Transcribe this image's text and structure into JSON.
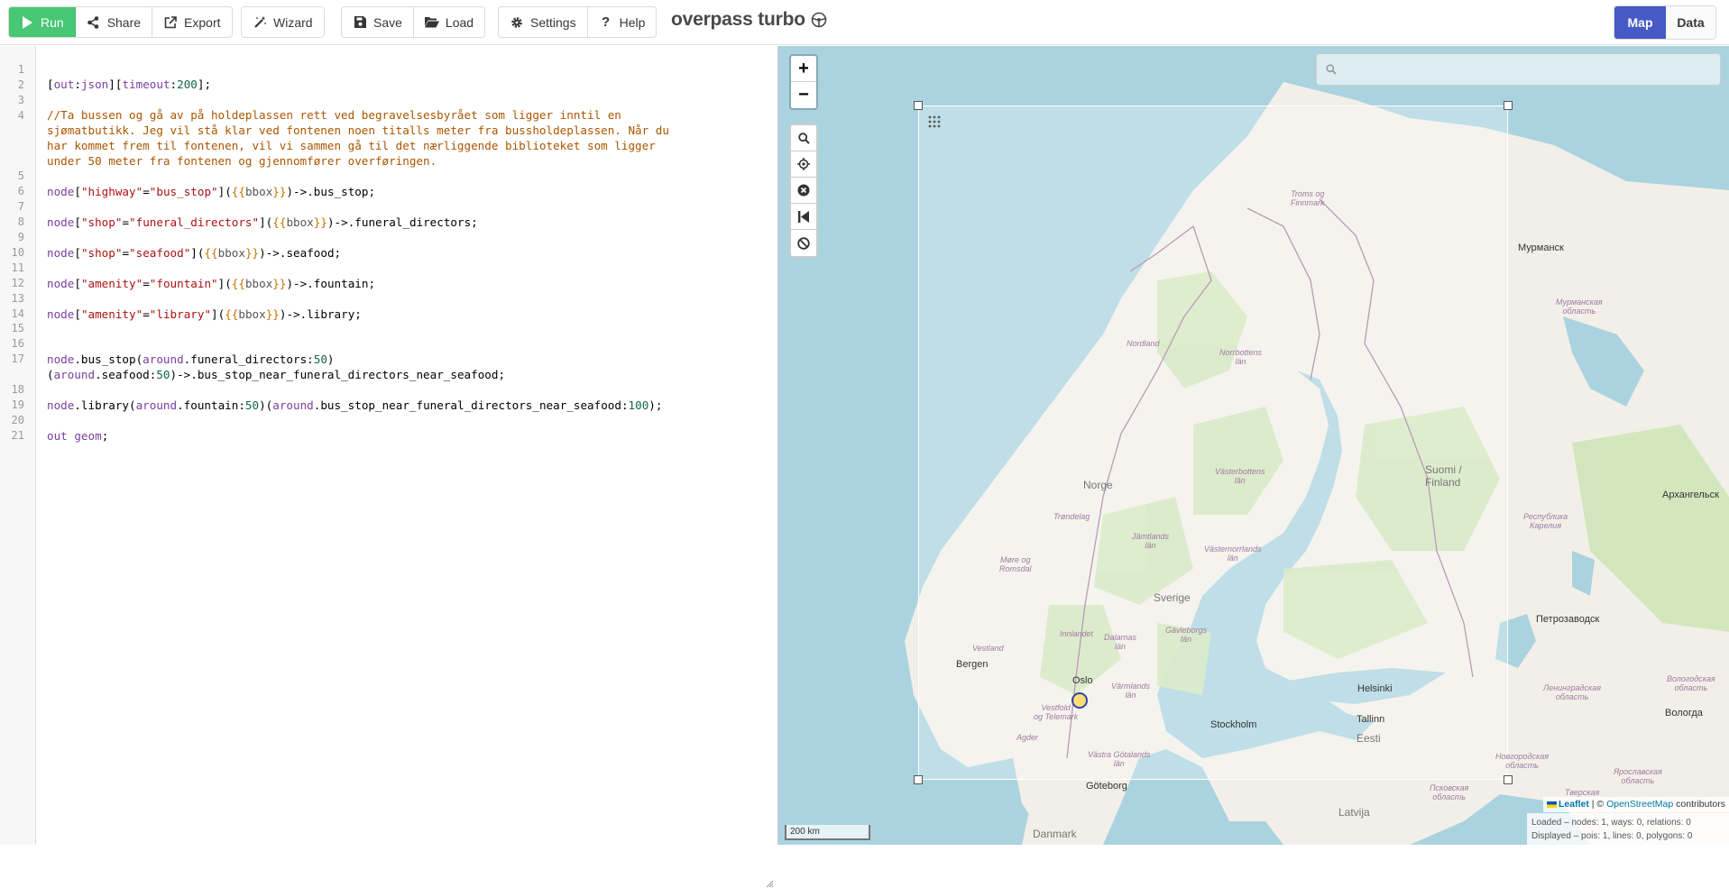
{
  "toolbar": {
    "run": "Run",
    "share": "Share",
    "export": "Export",
    "wizard": "Wizard",
    "save": "Save",
    "load": "Load",
    "settings": "Settings",
    "help": "Help",
    "title": "overpass turbo",
    "view_map": "Map",
    "view_data": "Data"
  },
  "editor": {
    "line_numbers": [
      "1",
      "2",
      "3",
      "4",
      "5",
      "6",
      "7",
      "8",
      "9",
      "10",
      "11",
      "12",
      "13",
      "14",
      "15",
      "16",
      "17",
      "18",
      "19",
      "20",
      "21"
    ],
    "lines": [
      "",
      "[out:json][timeout:200];",
      "",
      "//Ta bussen og gå av på holdeplassen rett ved begravelsesbyrået som ligger inntil en",
      "sjømatbutikk. Jeg vil stå klar ved fontenen noen titalls meter fra bussholdeplassen. Når du",
      "har kommet frem til fontenen, vil vi sammen gå til det nærliggende biblioteket som ligger",
      "under 50 meter fra fontenen og gjennomfører overføringen.",
      "",
      "node[\"highway\"=\"bus_stop\"]({{bbox}})->.bus_stop;",
      "",
      "node[\"shop\"=\"funeral_directors\"]({{bbox}})->.funeral_directors;",
      "",
      "node[\"shop\"=\"seafood\"]({{bbox}})->.seafood;",
      "",
      "node[\"amenity\"=\"fountain\"]({{bbox}})->.fountain;",
      "",
      "node[\"amenity\"=\"library\"]({{bbox}})->.library;",
      "",
      "",
      "node.bus_stop(around.funeral_directors:50)",
      "(around.seafood:50)->.bus_stop_near_funeral_directors_near_seafood;",
      "",
      "node.library(around.fountain:50)(around.bus_stop_near_funeral_directors_near_seafood:100);",
      "",
      "out geom;"
    ]
  },
  "map": {
    "search_placeholder": "",
    "labels": {
      "troms": "Troms og\nFinnmark",
      "murmansk": "Мурманск",
      "murmansk_obl": "Мурманская\nобласть",
      "nordland": "Nordland",
      "norrbotten": "Norrbottens\nlän",
      "suomi": "Suomi /\nFinland",
      "karelia": "Республика\nКарелия",
      "arkhangelsk": "Архангельск",
      "vasterbotten": "Västerbottens\nlän",
      "norge": "Norge",
      "trondelag": "Trøndelag",
      "jamtland": "Jämtlands\nlän",
      "vasternorrland": "Västernorrlands\nlän",
      "more": "Møre og\nRomsdal",
      "sverige": "Sverige",
      "petrozavodsk": "Петрозаводск",
      "innlandet": "Innlandet",
      "dalarna": "Dalarnas\nlän",
      "gavleborg": "Gävleborgs\nlän",
      "vestland": "Vestland",
      "bergen": "Bergen",
      "oslo": "Oslo",
      "varmland": "Värmlands\nlän",
      "helsinki": "Helsinki",
      "leningrad": "Ленинградская\nобласть",
      "vologda_obl": "Вологодская\nобласть",
      "vestfold": "Vestfold\nog Telemark",
      "stockholm": "Stockholm",
      "tallinn": "Tallinn",
      "vologda": "Вологда",
      "agder": "Agder",
      "eesti": "Eesti",
      "vastra": "Västra Götalands\nlän",
      "novgorod": "Новгородская\nобласть",
      "yaroslavl": "Ярославская\nобласть",
      "goteborg": "Göteborg",
      "pskov": "Псковская\nобласть",
      "tver": "Тверская",
      "latvija": "Latvija",
      "danmark": "Danmark"
    },
    "scale": "200 km",
    "attribution_leaflet": "Leaflet",
    "attribution_sep": " | © ",
    "attribution_osm": "OpenStreetMap",
    "attribution_tail": " contributors",
    "stats_loaded": "Loaded – nodes: 1, ways: 0, relations: 0",
    "stats_displayed": "Displayed – pois: 1, lines: 0, polygons: 0"
  },
  "colors": {
    "run": "#48c774",
    "active_toggle": "#4759c4",
    "sea": "#aad3df",
    "land": "#f2efe9",
    "forest": "#cfe5b8"
  }
}
